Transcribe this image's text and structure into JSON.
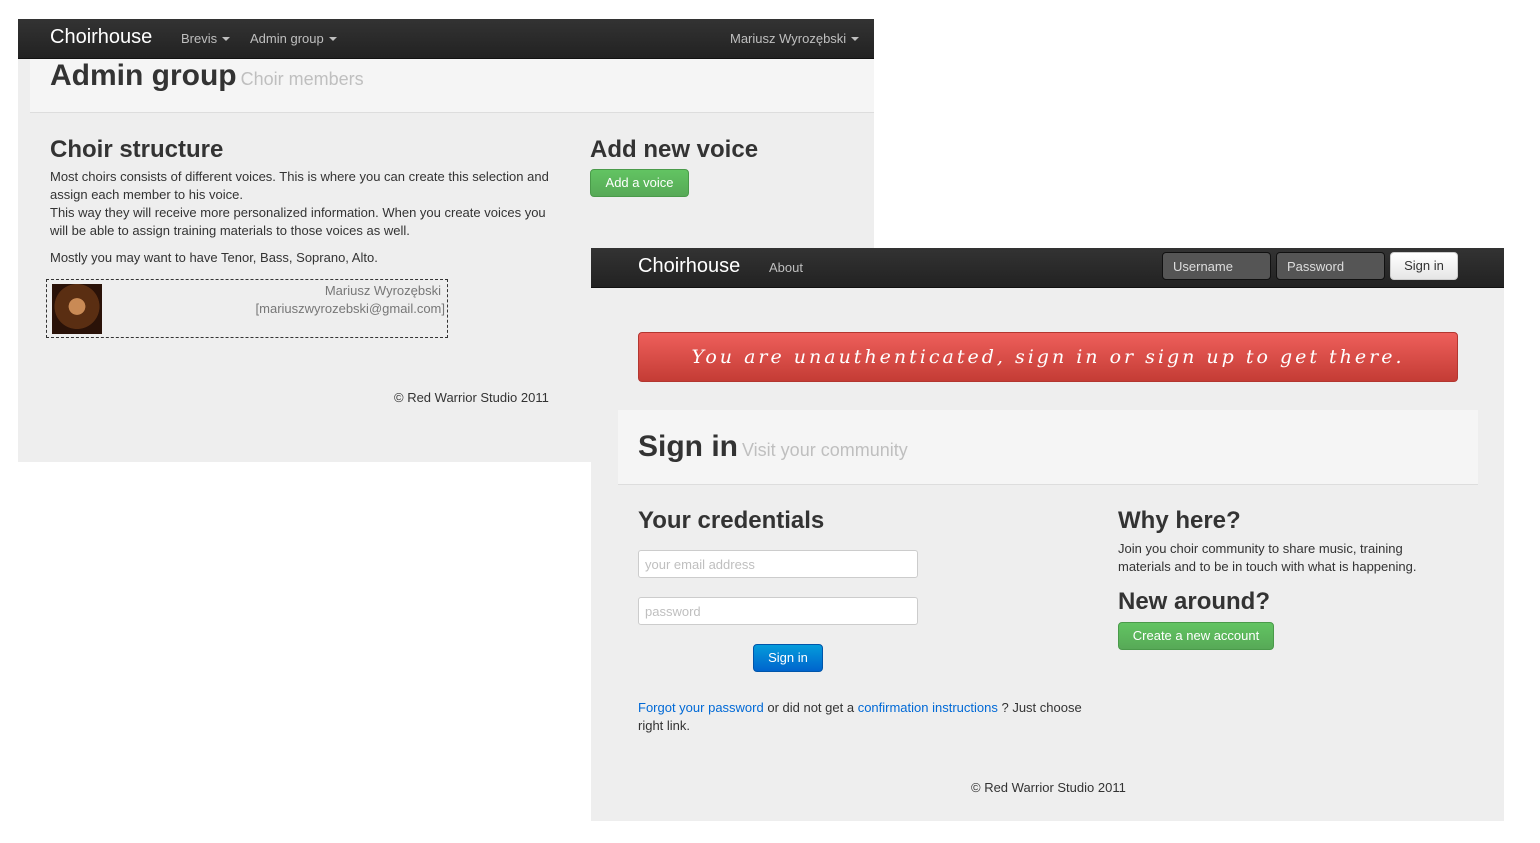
{
  "window1": {
    "navbar": {
      "brand": "Choirhouse",
      "items": [
        {
          "label": "Brevis"
        },
        {
          "label": "Admin group"
        }
      ],
      "user": "Mariusz Wyrozębski"
    },
    "header": {
      "title": "Admin group",
      "subtitle": "Choir members"
    },
    "structure": {
      "heading": "Choir structure",
      "para1": "Most choirs consists of different voices. This is where you can create this selection and assign each member to his voice.",
      "para2": "This way they will receive more personalized information. When you create voices you will be able to assign training materials to those voices as well.",
      "para3": "Mostly you may want to have Tenor, Bass, Soprano, Alto."
    },
    "member": {
      "name": "Mariusz Wyrozębski",
      "email": "[mariuszwyrozebski@gmail.com]"
    },
    "add_voice": {
      "heading": "Add new voice",
      "button": "Add a voice"
    },
    "footer": "© Red Warrior Studio 2011"
  },
  "window2": {
    "navbar": {
      "brand": "Choirhouse",
      "about": "About",
      "username_placeholder": "Username",
      "password_placeholder": "Password",
      "signin_button": "Sign in"
    },
    "alert": "You are unauthenticated, sign in or sign up to get there.",
    "header": {
      "title": "Sign in",
      "subtitle": "Visit your community"
    },
    "credentials": {
      "heading": "Your credentials",
      "email_placeholder": "your email address",
      "password_placeholder": "password",
      "signin_button": "Sign in"
    },
    "help": {
      "forgot_link": "Forgot your password",
      "middle": " or did not get a ",
      "confirm_link": "confirmation instructions",
      "end": " ? Just choose right link."
    },
    "why": {
      "heading": "Why here?",
      "text": "Join you choir community to share music, training materials and to be in touch with what is happening."
    },
    "new_around": {
      "heading": "New around?",
      "button": "Create a new account"
    },
    "footer": "© Red Warrior Studio 2011"
  }
}
